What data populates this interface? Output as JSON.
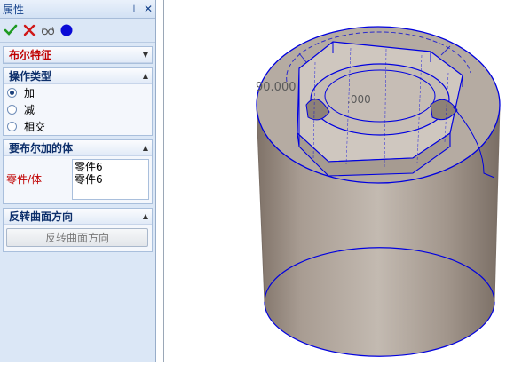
{
  "panel": {
    "title": "属性",
    "pin_glyph": "⊥",
    "close_glyph": "✕"
  },
  "toolbar": {
    "icons": [
      "ok-check-icon",
      "cancel-x-icon",
      "preview-glasses-icon",
      "blue-dot-icon"
    ]
  },
  "feature": {
    "title": "布尔特征"
  },
  "operation": {
    "title": "操作类型",
    "options": [
      "加",
      "减",
      "相交"
    ],
    "selected": "加"
  },
  "bodies": {
    "title": "要布尔加的体",
    "label": "零件/体",
    "items": [
      "零件6",
      "零件6"
    ]
  },
  "reverse": {
    "title": "反转曲面方向",
    "button": "反转曲面方向"
  },
  "viewport": {
    "dim_left": "90.000",
    "dim_inner": ".000"
  },
  "colors": {
    "panel_bg": "#dbe7f6",
    "accent_red": "#c00000",
    "edge_blue": "#0000e0",
    "solid": "#b7aca3"
  }
}
